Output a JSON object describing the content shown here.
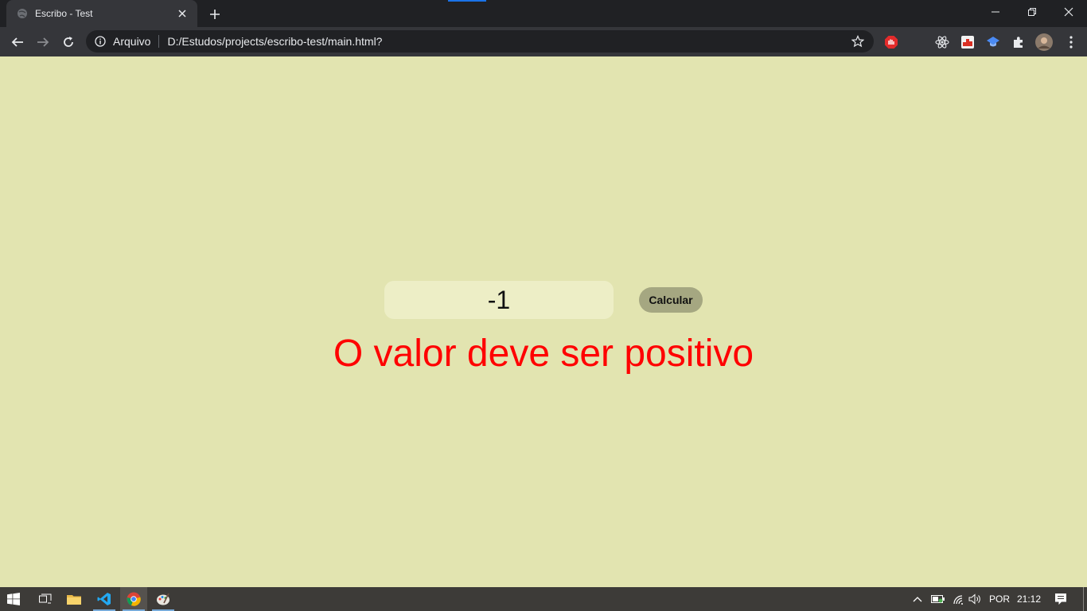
{
  "browser": {
    "tab": {
      "title": "Escribo - Test",
      "favicon": "globe-icon"
    },
    "omnibox": {
      "security_label": "Arquivo",
      "url": "D:/Estudos/projects/escribo-test/main.html?"
    },
    "window_controls": [
      "minimize-icon",
      "restore-icon",
      "close-icon"
    ],
    "extensions": [
      "adblock-icon",
      "react-devtools-icon",
      "extension-icon",
      "bookmark-extension-icon",
      "puzzle-icon",
      "profile-avatar"
    ]
  },
  "page": {
    "input_value": "-1",
    "button_label": "Calcular",
    "error_message": "O valor deve ser positivo"
  },
  "taskbar": {
    "apps": [
      "windows-start-icon",
      "task-view-icon",
      "file-explorer-icon",
      "vscode-icon",
      "chrome-icon",
      "paint-icon"
    ],
    "language": "POR",
    "time": "21:12"
  },
  "colors": {
    "page_background": "#e2e4b0",
    "input_background": "#edeec6",
    "button_background": "#a5a781",
    "error_text": "#ff0000"
  }
}
